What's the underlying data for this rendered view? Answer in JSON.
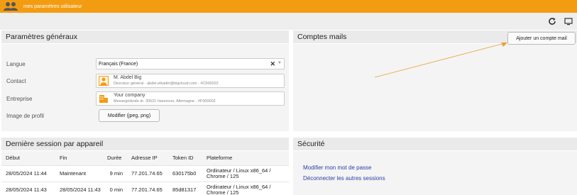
{
  "header": {
    "title": "mes paramètres utilisateur",
    "icon": "users-icon",
    "accent": "#f39c12"
  },
  "toolbar": {
    "refresh_icon": "refresh-icon",
    "display_icon": "monitor-icon"
  },
  "general": {
    "title": "Paramètres généraux",
    "language_label": "Langue",
    "language_value": "Français (France)",
    "contact_label": "Contact",
    "contact_name": "M. Abdel Big",
    "contact_detail": "Directeur général - abdel.elkadiri@bigcloud.com - #C000022",
    "company_label": "Entreprise",
    "company_name": "Your company",
    "company_detail": "Messegelände dr. 30521 Hannover, Allemagne - #F000002",
    "profile_label": "Image de profil",
    "profile_button": "Modifier (jpeg, png)"
  },
  "mail": {
    "title": "Comptes mails",
    "add_button": "Ajouter un compte mail"
  },
  "sessions": {
    "title": "Dernière session par appareil",
    "columns": [
      "Début",
      "Fin",
      "Durée",
      "Adresse IP",
      "Token ID",
      "Plateforme"
    ],
    "rows": [
      [
        "28/05/2024 11:44",
        "Maintenant",
        "9 min",
        "77.201.74.65",
        "630175b0",
        "Ordinateur / Linux x86_64 / Chrome / 125"
      ],
      [
        "28/05/2024 11:43",
        "28/05/2024 11:43",
        "0 min",
        "77.201.74.65",
        "85d81317",
        "Ordinateur / Linux x86_64 / Chrome / 125"
      ]
    ]
  },
  "security": {
    "title": "Sécurité",
    "change_password": "Modifier mon mot de passe",
    "logout_others": "Déconnecter les autres sessions"
  }
}
